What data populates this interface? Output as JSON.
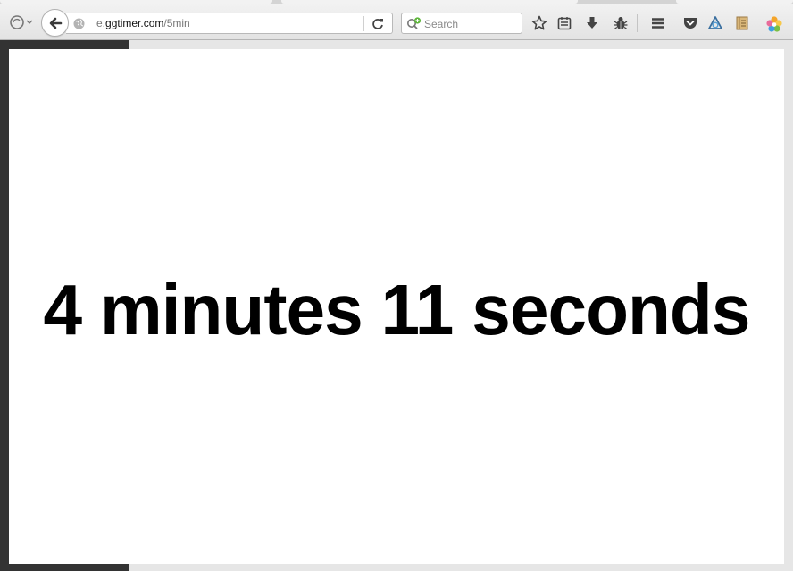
{
  "browser": {
    "url": {
      "prefix": "e.",
      "host": "ggtimer.com",
      "path": "/5min"
    },
    "search": {
      "placeholder": "Search"
    },
    "toolbar_icons": [
      "firefox-menu-icon",
      "back-icon",
      "globe-icon",
      "reload-icon",
      "search-icon",
      "bookmark-star-icon",
      "reading-list-icon",
      "download-icon",
      "bug-icon",
      "hamburger-menu-icon",
      "pocket-icon",
      "extension-icon",
      "notes-icon",
      "flower-icon"
    ]
  },
  "page": {
    "timer_text": "4 minutes 11 seconds"
  }
}
